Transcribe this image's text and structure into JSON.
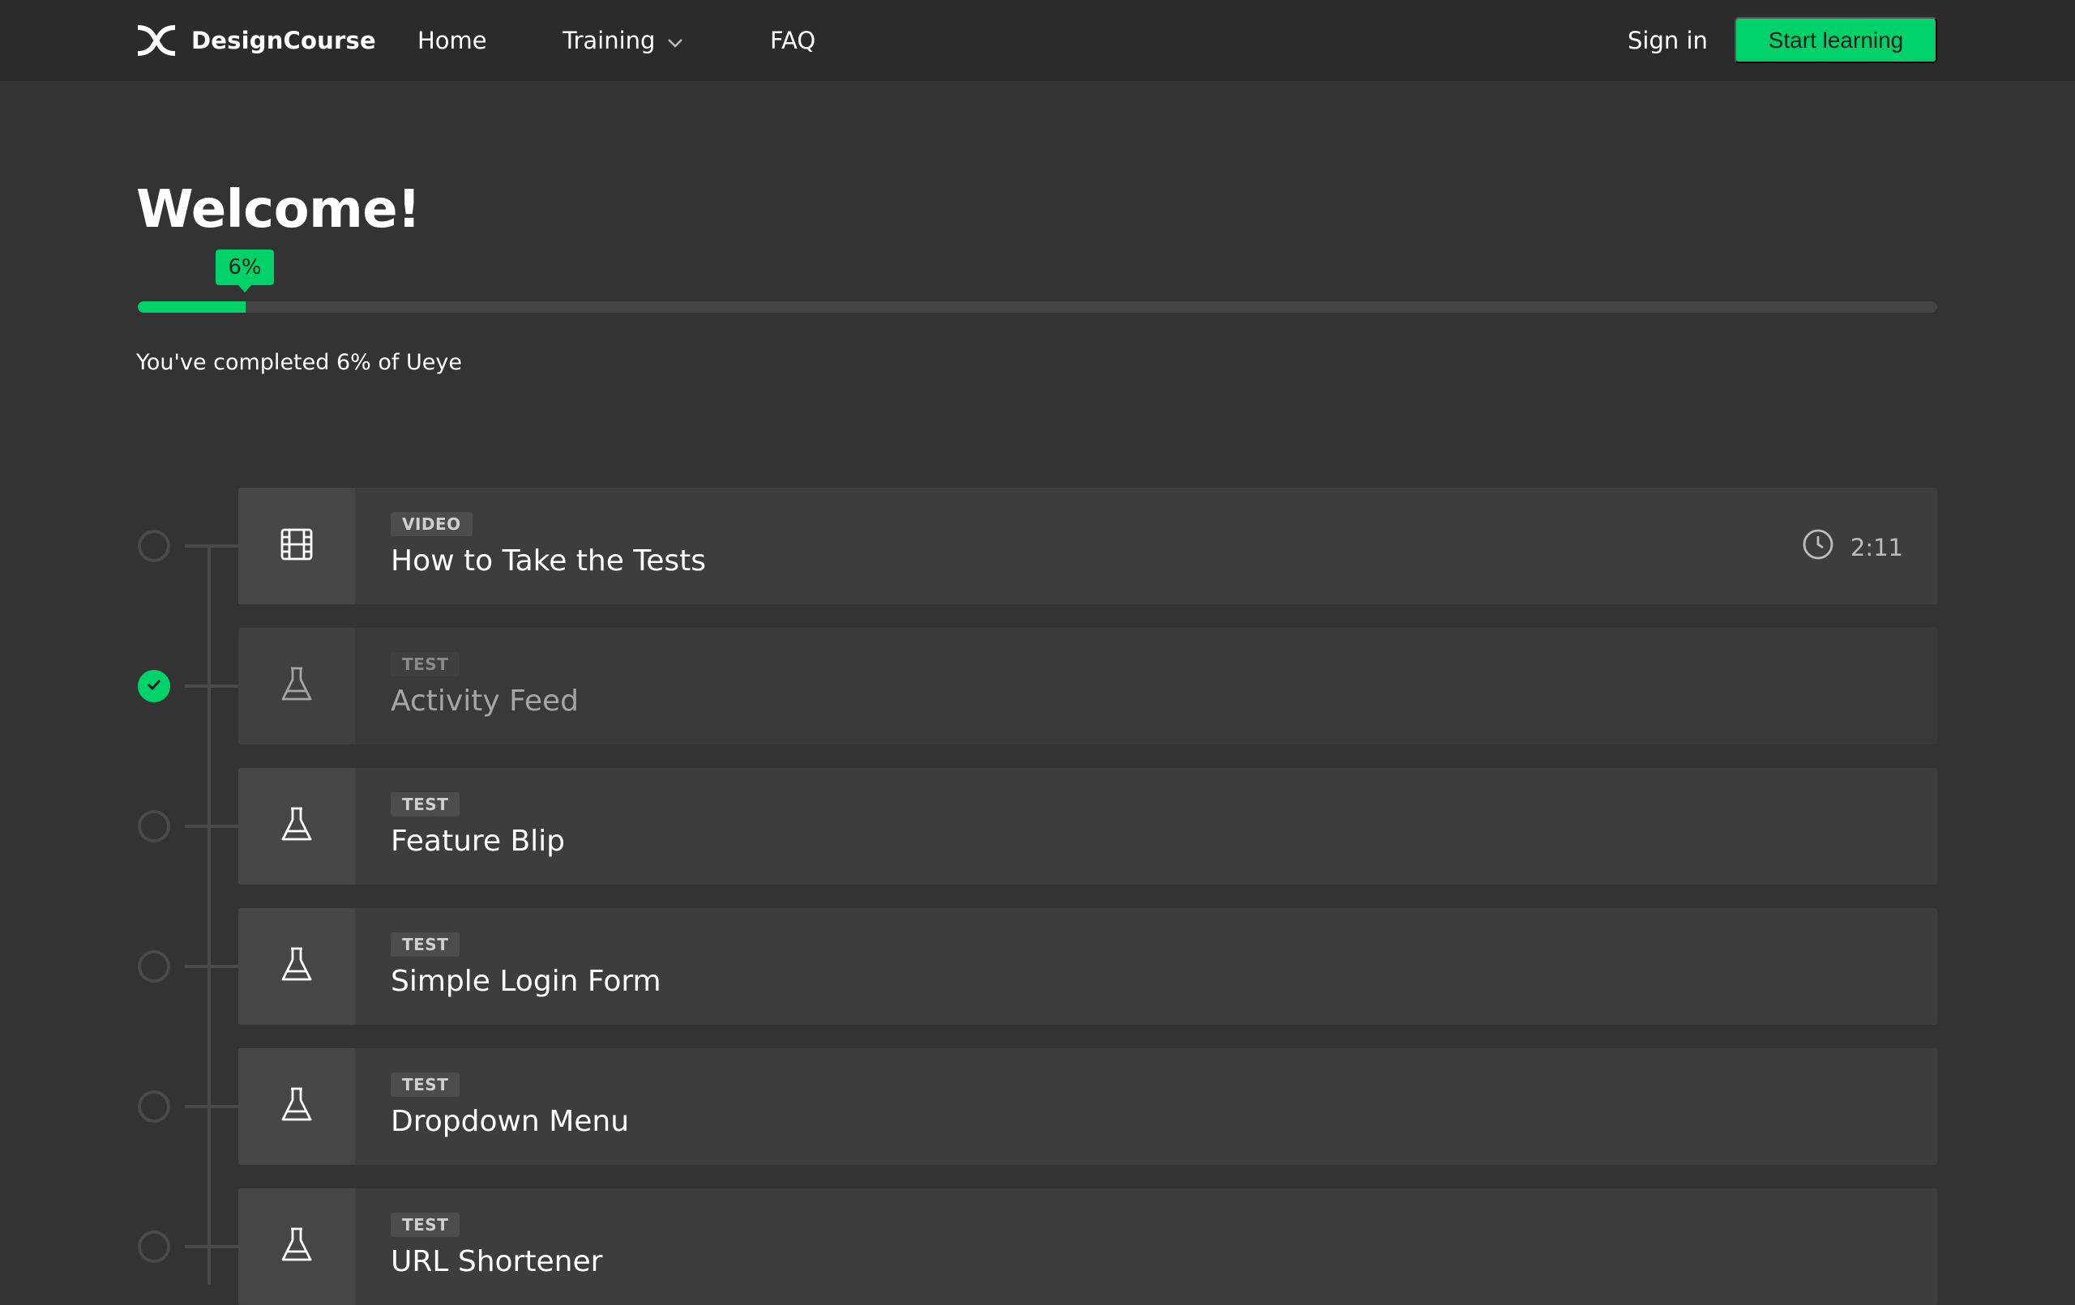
{
  "header": {
    "brand_name": "DesignCourse",
    "nav": {
      "home": "Home",
      "training": "Training",
      "faq": "FAQ"
    },
    "sign_in": "Sign in",
    "cta": "Start learning"
  },
  "colors": {
    "accent": "#00d26a",
    "background": "#333333",
    "header": "#2b2b2b",
    "card": "#3d3d3d"
  },
  "welcome": {
    "heading": "Welcome!",
    "progress_badge": "6%",
    "progress_percent": 6,
    "progress_text": "You've completed 6% of Ueye"
  },
  "lessons": [
    {
      "type": "VIDEO",
      "title": "How to Take the Tests",
      "duration": "2:11",
      "icon": "film-icon",
      "completed": false
    },
    {
      "type": "TEST",
      "title": "Activity Feed",
      "icon": "flask-icon",
      "completed": true
    },
    {
      "type": "TEST",
      "title": "Feature Blip",
      "icon": "flask-icon",
      "completed": false
    },
    {
      "type": "TEST",
      "title": "Simple Login Form",
      "icon": "flask-icon",
      "completed": false
    },
    {
      "type": "TEST",
      "title": "Dropdown Menu",
      "icon": "flask-icon",
      "completed": false
    },
    {
      "type": "TEST",
      "title": "URL Shortener",
      "icon": "flask-icon",
      "completed": false
    }
  ]
}
